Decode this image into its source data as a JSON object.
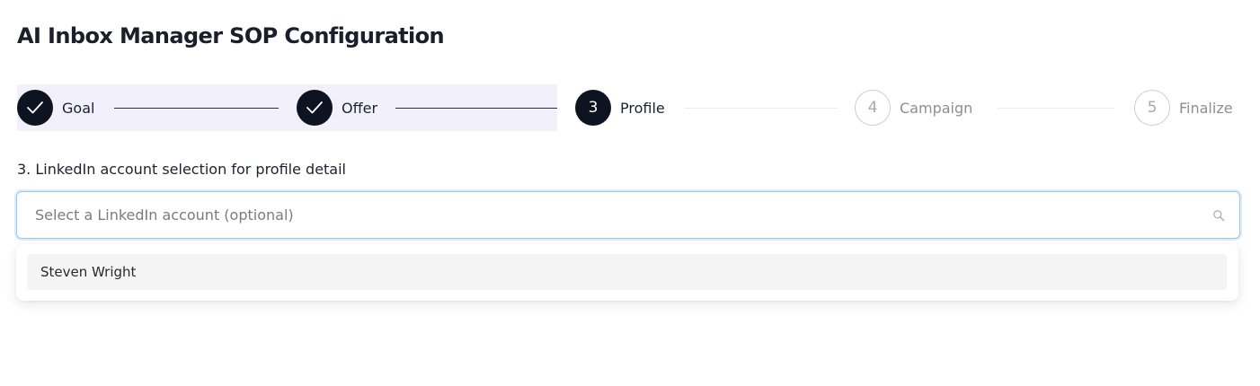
{
  "page": {
    "title": "AI Inbox Manager SOP Configuration"
  },
  "stepper": {
    "steps": [
      {
        "number": "1",
        "label": "Goal",
        "status": "done",
        "icon": "check-icon"
      },
      {
        "number": "2",
        "label": "Offer",
        "status": "done",
        "icon": "check-icon"
      },
      {
        "number": "3",
        "label": "Profile",
        "status": "active"
      },
      {
        "number": "4",
        "label": "Campaign",
        "status": "pending"
      },
      {
        "number": "5",
        "label": "Finalize",
        "status": "pending"
      }
    ]
  },
  "form": {
    "field_label": "3. LinkedIn account selection for profile detail",
    "select_value": "",
    "select_placeholder": "Select a LinkedIn account (optional)",
    "search_icon": "search-icon",
    "options": [
      {
        "label": "Steven Wright"
      }
    ]
  },
  "colors": {
    "step_done": "#0d1320",
    "completed_band": "#f2f0fa",
    "focus_border": "#9cc7ee"
  }
}
